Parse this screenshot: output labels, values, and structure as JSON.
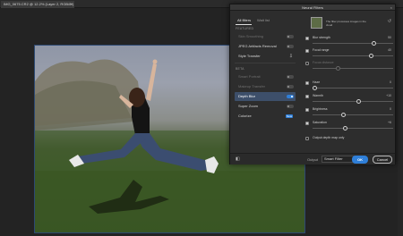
{
  "document": {
    "tab_title": "IMG_0675.CR2 @ 12.2% (Layer 2, RGB/8*)",
    "close_glyph": "×"
  },
  "dialog": {
    "title": "Neural Filters",
    "close_glyph": "×",
    "tabs": {
      "all": "All filters",
      "wait": "Wait list"
    },
    "sections": {
      "featured": "FEATURED",
      "beta": "BETA"
    },
    "featured_filters": [
      {
        "label": "Skin Smoothing",
        "state": "dim"
      },
      {
        "label": "JPEG Artifacts Removal",
        "state": "on"
      },
      {
        "label": "Style Transfer",
        "state": "cloud"
      }
    ],
    "beta_filters": [
      {
        "label": "Smart Portrait",
        "state": "dim"
      },
      {
        "label": "Makeup Transfer",
        "state": "dim"
      },
      {
        "label": "Depth Blur",
        "state": "selected"
      },
      {
        "label": "Super Zoom",
        "state": "on"
      },
      {
        "label": "Colorize",
        "state": "new",
        "badge": "New"
      }
    ],
    "preview_caption": "The filter processes images in the cloud",
    "sliders": [
      {
        "label": "Blur strength",
        "value": "50",
        "checked": true,
        "level": 0.78
      },
      {
        "label": "Focal range",
        "value": "40",
        "checked": true,
        "level": 0.74
      },
      {
        "label": "Focus distance",
        "value": "",
        "checked": false,
        "level": 0.3,
        "dim": true
      },
      {
        "label": "Haze",
        "value": "0",
        "checked": true,
        "level": 0.0
      },
      {
        "label": "Warmth",
        "value": "+10",
        "checked": true,
        "level": 0.58
      },
      {
        "label": "Brightness",
        "value": "0",
        "checked": true,
        "level": 0.38
      },
      {
        "label": "Saturation",
        "value": "+6",
        "checked": true,
        "level": 0.4
      }
    ],
    "depth_map_option": "Output depth map only",
    "footer": {
      "output_label": "Output",
      "output_value": "Smart Filter",
      "ok": "OK",
      "cancel": "Cancel"
    }
  },
  "colors": {
    "accent": "#2f7fd8",
    "panel": "#2d2d2d",
    "selected_row": "#3d4f6a"
  }
}
